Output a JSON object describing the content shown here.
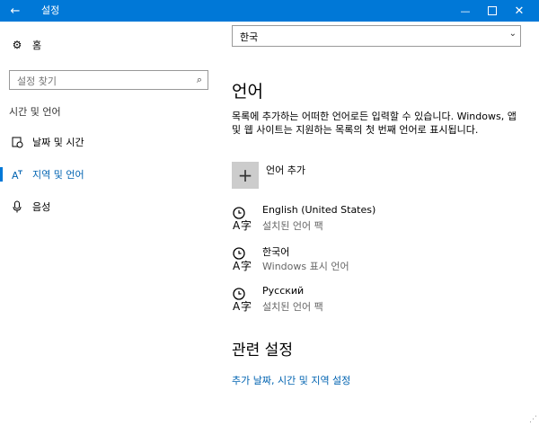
{
  "window": {
    "title": "설정",
    "back_icon": "back-arrow-icon",
    "minimize": "—",
    "maximize_icon": "maximize-icon",
    "close": "✕"
  },
  "sidebar": {
    "home": {
      "label": "홈",
      "icon": "gear-icon"
    },
    "search": {
      "placeholder": "설정 찾기",
      "icon": "search-icon"
    },
    "section_header": "시간 및 언어",
    "items": [
      {
        "label": "날짜 및 시간",
        "icon": "calendar-clock-icon",
        "active": false
      },
      {
        "label": "지역 및 언어",
        "icon": "region-language-icon",
        "active": true
      },
      {
        "label": "음성",
        "icon": "microphone-icon",
        "active": false
      }
    ]
  },
  "main": {
    "country_select": {
      "value": "한국"
    },
    "languages_header": "언어",
    "description": "목록에 추가하는 어떠한 언어로든 입력할 수 있습니다. Windows, 앱 및 웹 사이트는 지원하는 목록의 첫 번째 언어로 표시됩니다.",
    "add_language": "언어 추가",
    "languages": [
      {
        "name": "English (United States)",
        "status": "설치된 언어 팩"
      },
      {
        "name": "한국어",
        "status": "Windows 표시 언어"
      },
      {
        "name": "Русский",
        "status": "설치된 언어 팩"
      }
    ],
    "related_header": "관련 설정",
    "related_link": "추가 날짜, 시간 및 지역 설정"
  },
  "colors": {
    "accent": "#0078d7",
    "link": "#0063b1"
  }
}
